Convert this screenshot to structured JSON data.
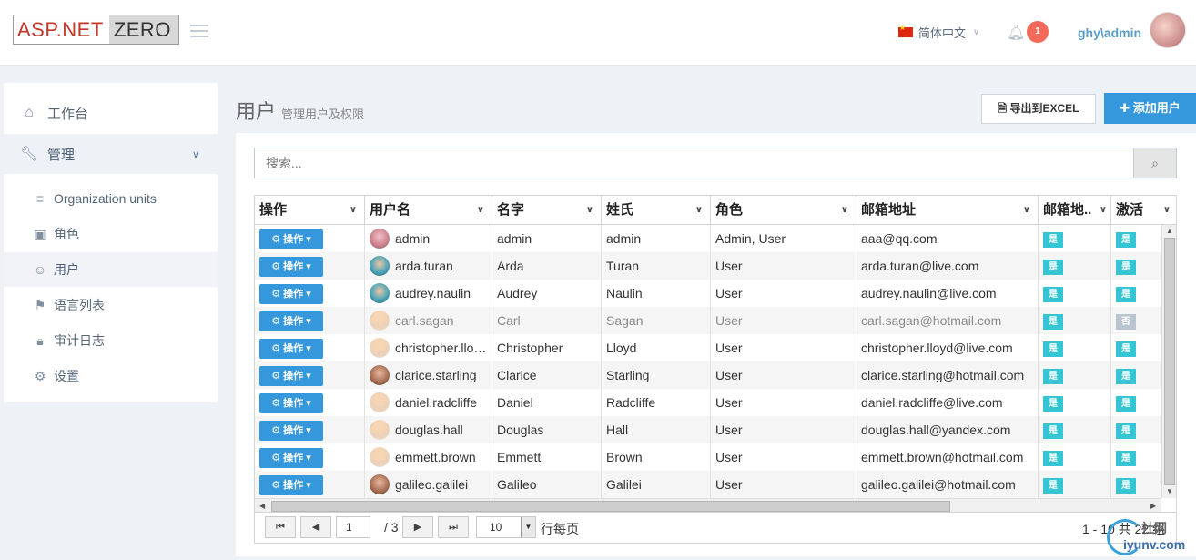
{
  "header": {
    "logo_part1": "ASP.NET",
    "logo_part2": "ZERO",
    "language": "简体中文",
    "notification_count": "1",
    "username": "ghy\\admin"
  },
  "sidebar": {
    "items": [
      {
        "label": "工作台",
        "icon": "home-icon"
      },
      {
        "label": "管理",
        "icon": "wrench-icon"
      }
    ],
    "subitems": [
      {
        "label": "Organization units",
        "icon": "layers-icon"
      },
      {
        "label": "角色",
        "icon": "briefcase-icon"
      },
      {
        "label": "用户",
        "icon": "users-icon"
      },
      {
        "label": "语言列表",
        "icon": "flag-icon"
      },
      {
        "label": "审计日志",
        "icon": "lock-icon"
      },
      {
        "label": "设置",
        "icon": "gear-icon"
      }
    ]
  },
  "page": {
    "title": "用户",
    "subtitle": "管理用户及权限",
    "export_label": "导出到EXCEL",
    "add_label": "添加用户",
    "search_placeholder": "搜索..."
  },
  "grid": {
    "columns": [
      "操作",
      "用户名",
      "名字",
      "姓氏",
      "角色",
      "邮箱地址",
      "邮箱地..",
      "激活"
    ],
    "op_label": "操作",
    "rows": [
      {
        "username": "admin",
        "name": "admin",
        "surname": "admin",
        "roles": "Admin, User",
        "email": "aaa@qq.com",
        "confirmed": "是",
        "active": "是"
      },
      {
        "username": "arda.turan",
        "name": "Arda",
        "surname": "Turan",
        "roles": "User",
        "email": "arda.turan@live.com",
        "confirmed": "是",
        "active": "是"
      },
      {
        "username": "audrey.naulin",
        "name": "Audrey",
        "surname": "Naulin",
        "roles": "User",
        "email": "audrey.naulin@live.com",
        "confirmed": "是",
        "active": "是"
      },
      {
        "username": "carl.sagan",
        "name": "Carl",
        "surname": "Sagan",
        "roles": "User",
        "email": "carl.sagan@hotmail.com",
        "confirmed": "是",
        "active": "否"
      },
      {
        "username": "christopher.llo…",
        "name": "Christopher",
        "surname": "Lloyd",
        "roles": "User",
        "email": "christopher.lloyd@live.com",
        "confirmed": "是",
        "active": "是"
      },
      {
        "username": "clarice.starling",
        "name": "Clarice",
        "surname": "Starling",
        "roles": "User",
        "email": "clarice.starling@hotmail.com",
        "confirmed": "是",
        "active": "是"
      },
      {
        "username": "daniel.radcliffe",
        "name": "Daniel",
        "surname": "Radcliffe",
        "roles": "User",
        "email": "daniel.radcliffe@live.com",
        "confirmed": "是",
        "active": "是"
      },
      {
        "username": "douglas.hall",
        "name": "Douglas",
        "surname": "Hall",
        "roles": "User",
        "email": "douglas.hall@yandex.com",
        "confirmed": "是",
        "active": "是"
      },
      {
        "username": "emmett.brown",
        "name": "Emmett",
        "surname": "Brown",
        "roles": "User",
        "email": "emmett.brown@hotmail.com",
        "confirmed": "是",
        "active": "是"
      },
      {
        "username": "galileo.galilei",
        "name": "Galileo",
        "surname": "Galilei",
        "roles": "User",
        "email": "galileo.galilei@hotmail.com",
        "confirmed": "是",
        "active": "是"
      }
    ]
  },
  "pager": {
    "current_page": "1",
    "total_pages": "/ 3",
    "page_size": "10",
    "per_page_label": "行每页",
    "summary": "1 - 10 共 22 组"
  },
  "watermark": {
    "line1": "社网",
    "line2": "iyunv.com"
  }
}
